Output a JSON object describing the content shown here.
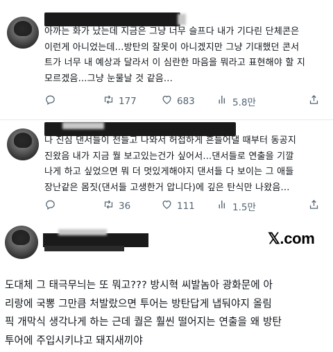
{
  "tweets": [
    {
      "lines": [
        "아까는 화가 났는데 지금은 그냥 너무 슬프다 내가 기다린 단체콘은",
        "이런게 아니었는데...방탄의 잘못이 아니겠지만 그냥 기대했던 콘서",
        "트가 너무 내 예상과 달라서 이 심란한 마음을 뭐라고 표현해야 할 지",
        "모르겠음...그냥 눈물날 것 같음..."
      ],
      "replies": "",
      "retweets": "177",
      "likes": "683",
      "views": "5.8만"
    },
    {
      "lines": [
        "나 진심 댄서들이 천들고 나와서 허접하게 흔들어댈 때부터 동공지",
        "진왔음 내가 지금 뭘 보고있는건가 싶어서...댄서들로 연출을 기깔",
        "나게 하고 싶었으면 뭐 더 멋있게해야지 댄서들 다 보이는 그 애들",
        "장난같은 몸짓(댄서들 고생한거 압니다)에 깊은 탄식만 나왔음..."
      ],
      "replies": "",
      "retweets": "36",
      "likes": "111",
      "views": "1.5만"
    }
  ],
  "watermark": "𝕏.com",
  "main_post": {
    "lines": [
      "도대체 그 태극무늬는 또 뭐고??? 방시혁 씨발놈아 광화문에 아",
      "리랑에 국뽕 그만큼 처발랐으면 투어는 방탄답게 냅둬야지 올림",
      "픽 개막식 생각나게 하는 근데 퀄은 훨씬 떨어지는 연출을 왜 방탄",
      "투어에 주입시키냐고 돼지새끼야"
    ]
  },
  "icons": {
    "reply": "speech-bubble-icon",
    "retweet": "retweet-arrows-icon",
    "like": "heart-icon",
    "views": "bar-chart-icon",
    "share": "share-upload-icon"
  },
  "colors": {
    "text": "#0f1419",
    "secondary": "#536471"
  }
}
